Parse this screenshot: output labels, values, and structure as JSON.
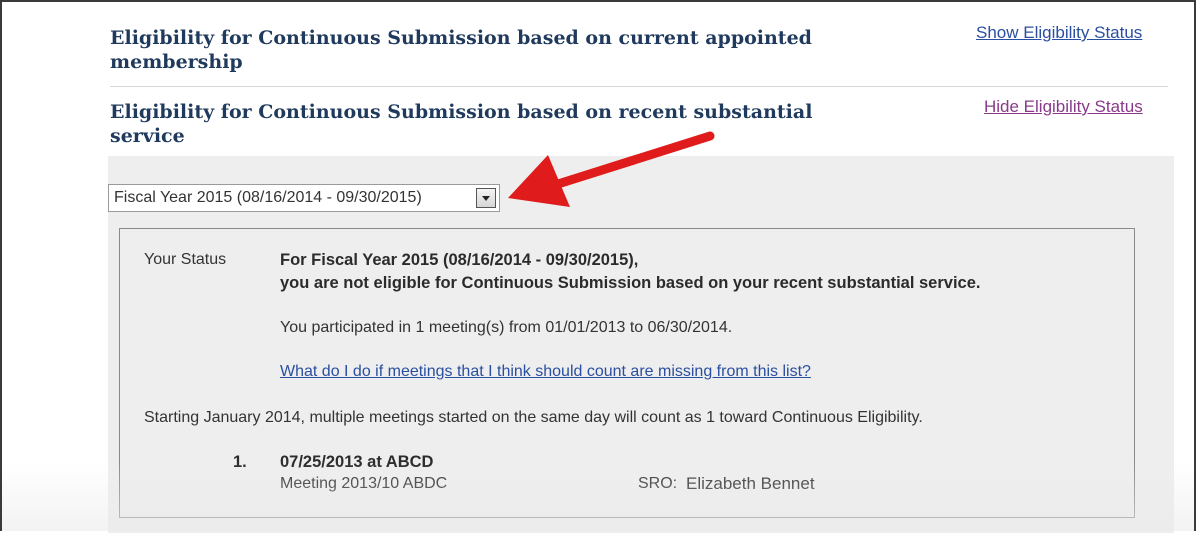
{
  "sections": [
    {
      "title_line1": "Eligibility for Continuous Submission based on current appointed",
      "title_line2": "membership",
      "toggle_label": "Show Eligibility Status"
    },
    {
      "title_line1": "Eligibility for Continuous Submission based on recent substantial",
      "title_line2": "service",
      "toggle_label": "Hide Eligibility Status"
    }
  ],
  "fiscal_year_select": {
    "selected": "Fiscal Year 2015 (08/16/2014 - 09/30/2015)"
  },
  "status": {
    "label": "Your Status",
    "heading_line1": "For Fiscal Year 2015 (08/16/2014 - 09/30/2015),",
    "heading_line2": "you are not eligible for Continuous Submission based on your recent substantial service.",
    "participation": "You participated in 1 meeting(s) from 01/01/2013 to 06/30/2014.",
    "help_link": "What do I do if meetings that I think should count are missing from this list?",
    "note": "Starting January 2014, multiple meetings started on the same day will count as 1 toward Continuous Eligibility."
  },
  "meetings": [
    {
      "number": "1.",
      "title": "07/25/2013 at ABCD",
      "meeting": "Meeting 2013/10 ABDC",
      "sro_label": "SRO:",
      "sro_name": "Elizabeth Bennet"
    }
  ],
  "colors": {
    "title": "#1f3a5c",
    "link_show": "#2a4fa0",
    "link_hide": "#8a3a8a",
    "panel_bg": "#eeeeee",
    "annotation_arrow": "#e01b1b"
  }
}
